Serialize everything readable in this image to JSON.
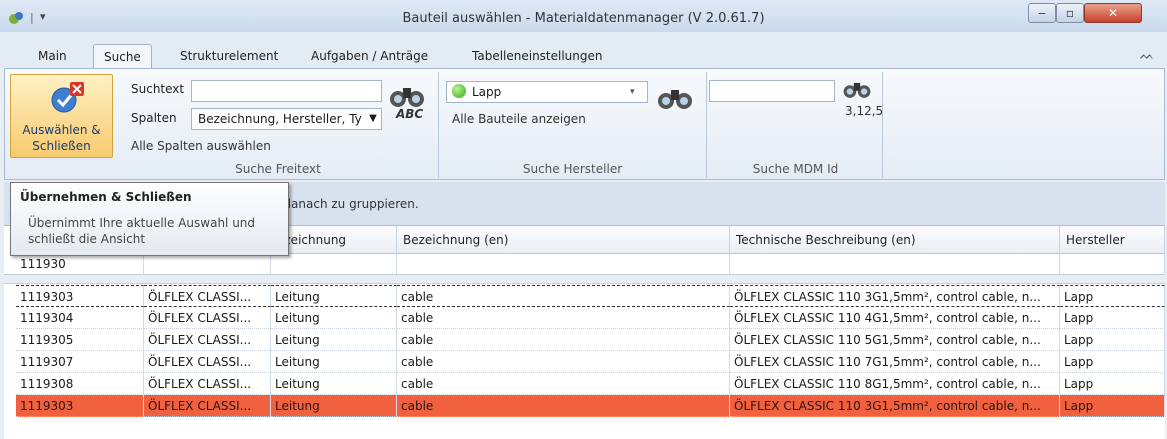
{
  "window": {
    "title": "Bauteil auswählen - Materialdatenmanager (V 2.0.61.7)",
    "quick_access_sep": "|",
    "quick_access_dropdown": "▾",
    "minimize": "‒",
    "maximize": "▫",
    "close": "✕"
  },
  "ribbon": {
    "tabs": [
      "Main",
      "Suche",
      "Strukturelement",
      "Aufgaben / Anträge",
      "Tabelleneinstellungen"
    ],
    "collapse_glyph": "ᨓ",
    "select_close_label": "Auswählen & Schließen",
    "freitext": {
      "suchtext_label": "Suchtext",
      "suchtext_value": "",
      "spalten_label": "Spalten",
      "spalten_value": "Bezeichnung, Hersteller, Ty",
      "alle_spalten": "Alle Spalten auswählen",
      "abc_label": "ABC",
      "group_label": "Suche Freitext"
    },
    "hersteller": {
      "selected": "Lapp",
      "alle_bauteile": "Alle Bauteile anzeigen",
      "group_label": "Suche Hersteller"
    },
    "mdm": {
      "id_value": "",
      "hint": "3,12,5",
      "group_label": "Suche MDM Id"
    }
  },
  "groupbar": {
    "text": "n danach zu gruppieren."
  },
  "tooltip": {
    "title": "Übernehmen & Schließen",
    "body": "Übernimmt Ihre aktuelle Auswahl und schließt die Ansicht"
  },
  "grid": {
    "headers": [
      "",
      "",
      "ezeichnung",
      "Bezeichnung (en)",
      "Technische Beschreibung (en)",
      "Hersteller"
    ],
    "filter_row": [
      "111930",
      "",
      "",
      "",
      "",
      ""
    ],
    "rows": [
      [
        "1119303",
        "ÖLFLEX CLASSI...",
        "Leitung",
        "cable",
        "ÖLFLEX CLASSIC 110 3G1,5mm², control cable, n...",
        "Lapp"
      ],
      [
        "1119304",
        "ÖLFLEX CLASSI...",
        "Leitung",
        "cable",
        "ÖLFLEX CLASSIC 110 4G1,5mm², control cable, n...",
        "Lapp"
      ],
      [
        "1119305",
        "ÖLFLEX CLASSI...",
        "Leitung",
        "cable",
        "ÖLFLEX CLASSIC 110 5G1,5mm², control cable, n...",
        "Lapp"
      ],
      [
        "1119307",
        "ÖLFLEX CLASSI...",
        "Leitung",
        "cable",
        "ÖLFLEX CLASSIC 110 7G1,5mm², control cable, n...",
        "Lapp"
      ],
      [
        "1119308",
        "ÖLFLEX CLASSI...",
        "Leitung",
        "cable",
        "ÖLFLEX CLASSIC 110 8G1,5mm², control cable, n...",
        "Lapp"
      ],
      [
        "1119303",
        "ÖLFLEX CLASSI...",
        "Leitung",
        "cable",
        "ÖLFLEX CLASSIC 110 3G1,5mm², control cable, n...",
        "Lapp"
      ]
    ],
    "selected_row_color": "#f1613f"
  }
}
